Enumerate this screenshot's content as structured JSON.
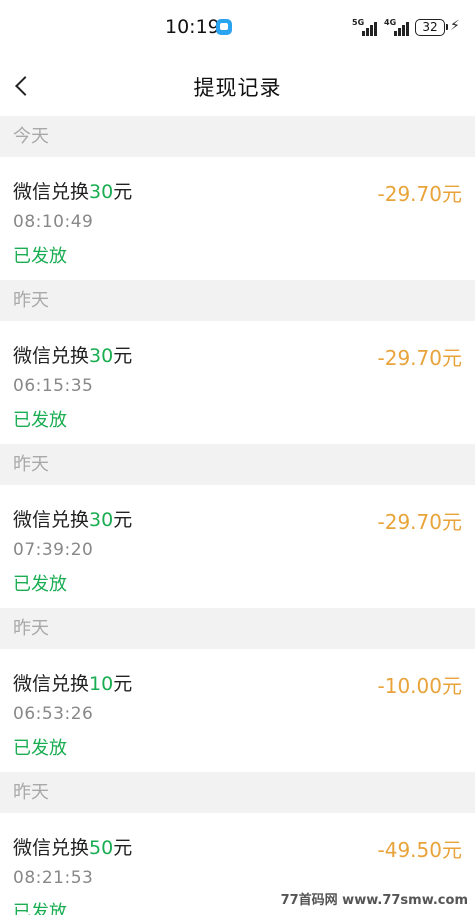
{
  "status_bar": {
    "time": "10:19",
    "network_1": "5G",
    "network_2": "4G",
    "battery": "32",
    "charging_icon": "bolt-icon"
  },
  "nav": {
    "title": "提现记录",
    "back_icon": "chevron-left-icon"
  },
  "records": [
    {
      "day": "今天",
      "title_prefix": "微信兑换",
      "title_amount": "30",
      "title_suffix": "元",
      "time": "08:10:49",
      "status": "已发放",
      "amount": "-29.70元"
    },
    {
      "day": "昨天",
      "title_prefix": "微信兑换",
      "title_amount": "30",
      "title_suffix": "元",
      "time": "06:15:35",
      "status": "已发放",
      "amount": "-29.70元"
    },
    {
      "day": "昨天",
      "title_prefix": "微信兑换",
      "title_amount": "30",
      "title_suffix": "元",
      "time": "07:39:20",
      "status": "已发放",
      "amount": "-29.70元"
    },
    {
      "day": "昨天",
      "title_prefix": "微信兑换",
      "title_amount": "10",
      "title_suffix": "元",
      "time": "06:53:26",
      "status": "已发放",
      "amount": "-10.00元"
    },
    {
      "day": "昨天",
      "title_prefix": "微信兑换",
      "title_amount": "50",
      "title_suffix": "元",
      "time": "08:21:53",
      "status": "已发放",
      "amount": "-49.50元"
    }
  ],
  "watermark": "77首码网 www.77smw.com",
  "colors": {
    "green": "#1aad52",
    "orange": "#e8a33a",
    "header_bg": "#f2f2f2"
  }
}
